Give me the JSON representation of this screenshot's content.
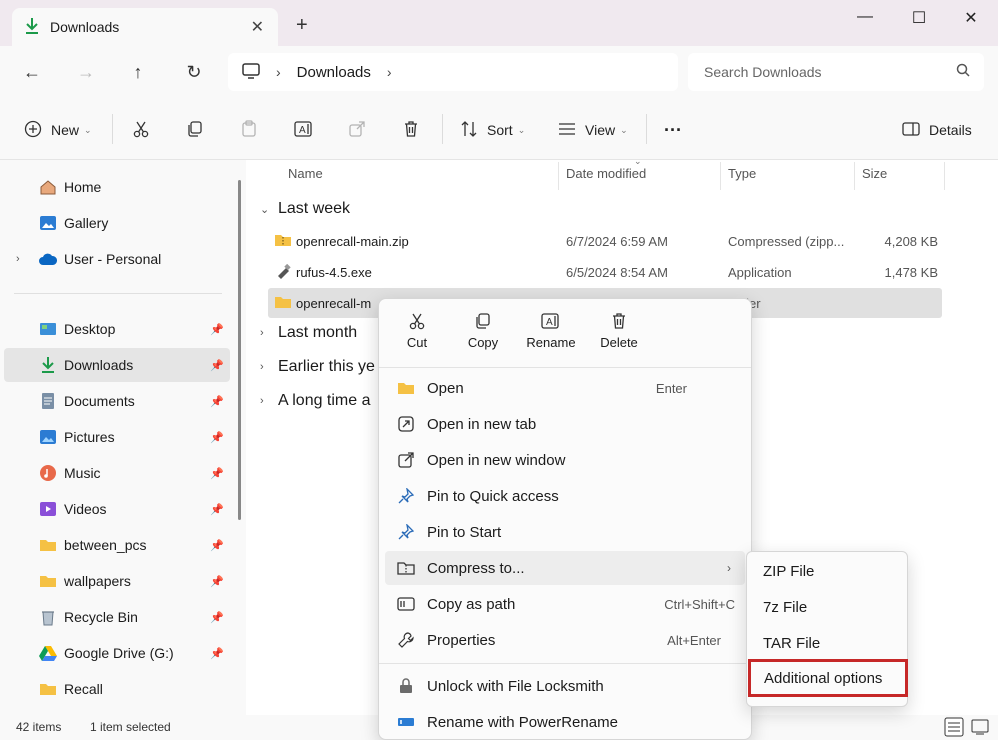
{
  "colors": {
    "accent": "#0067c0",
    "folder": "#f5c144",
    "highlight_box": "#c62828"
  },
  "window": {
    "tab_title": "Downloads",
    "tab_close_icon": "close-icon",
    "new_tab_icon": "plus-icon"
  },
  "nav": {
    "breadcrumb": [
      "Downloads"
    ],
    "search_placeholder": "Search Downloads"
  },
  "toolbar": {
    "new_label": "New",
    "sort_label": "Sort",
    "view_label": "View",
    "more_label": "···",
    "details_label": "Details"
  },
  "sidebar": {
    "items": [
      {
        "label": "Home",
        "icon": "home-icon"
      },
      {
        "label": "Gallery",
        "icon": "gallery-icon"
      },
      {
        "label": "User - Personal",
        "icon": "cloud-icon"
      },
      {
        "label": "Desktop",
        "icon": "desktop-icon"
      },
      {
        "label": "Downloads",
        "icon": "download-icon"
      },
      {
        "label": "Documents",
        "icon": "document-icon"
      },
      {
        "label": "Pictures",
        "icon": "pictures-icon"
      },
      {
        "label": "Music",
        "icon": "music-icon"
      },
      {
        "label": "Videos",
        "icon": "videos-icon"
      },
      {
        "label": "between_pcs",
        "icon": "folder-icon"
      },
      {
        "label": "wallpapers",
        "icon": "folder-icon"
      },
      {
        "label": "Recycle Bin",
        "icon": "recycle-bin-icon"
      },
      {
        "label": "Google Drive (G:)",
        "icon": "google-drive-icon"
      },
      {
        "label": "Recall",
        "icon": "folder-icon"
      }
    ]
  },
  "columns": {
    "name": "Name",
    "date": "Date modified",
    "type": "Type",
    "size": "Size"
  },
  "groups": {
    "last_week": "Last week",
    "last_month": "Last month",
    "earlier": "Earlier this ye",
    "long_time": "A long time a"
  },
  "files": [
    {
      "name": "openrecall-main.zip",
      "date": "6/7/2024 6:59 AM",
      "type": "Compressed (zipp...",
      "size": "4,208 KB"
    },
    {
      "name": "rufus-4.5.exe",
      "date": "6/5/2024 8:54 AM",
      "type": "Application",
      "size": "1,478 KB"
    },
    {
      "name": "openrecall-m",
      "type": "folder"
    }
  ],
  "status": {
    "items": "42 items",
    "selected": "1 item selected"
  },
  "context_menu": {
    "top": [
      {
        "label": "Cut",
        "icon": "cut-icon"
      },
      {
        "label": "Copy",
        "icon": "copy-icon"
      },
      {
        "label": "Rename",
        "icon": "rename-icon"
      },
      {
        "label": "Delete",
        "icon": "delete-icon"
      }
    ],
    "items": [
      {
        "label": "Open",
        "shortcut": "Enter",
        "icon": "folder-icon"
      },
      {
        "label": "Open in new tab",
        "shortcut": "",
        "icon": "new-tab-icon"
      },
      {
        "label": "Open in new window",
        "shortcut": "",
        "icon": "new-window-icon"
      },
      {
        "label": "Pin to Quick access",
        "shortcut": "",
        "icon": "pin-icon"
      },
      {
        "label": "Pin to Start",
        "shortcut": "",
        "icon": "pin-icon"
      },
      {
        "label": "Compress to...",
        "shortcut": "",
        "icon": "compress-icon"
      },
      {
        "label": "Copy as path",
        "shortcut": "Ctrl+Shift+C",
        "icon": "path-icon"
      },
      {
        "label": "Properties",
        "shortcut": "Alt+Enter",
        "icon": "wrench-icon"
      },
      {
        "label": "Unlock with File Locksmith",
        "shortcut": "",
        "icon": "lock-icon"
      },
      {
        "label": "Rename with PowerRename",
        "shortcut": "",
        "icon": "powerrename-icon"
      }
    ]
  },
  "submenu": {
    "items": [
      "ZIP File",
      "7z File",
      "TAR File",
      "Additional options"
    ]
  }
}
